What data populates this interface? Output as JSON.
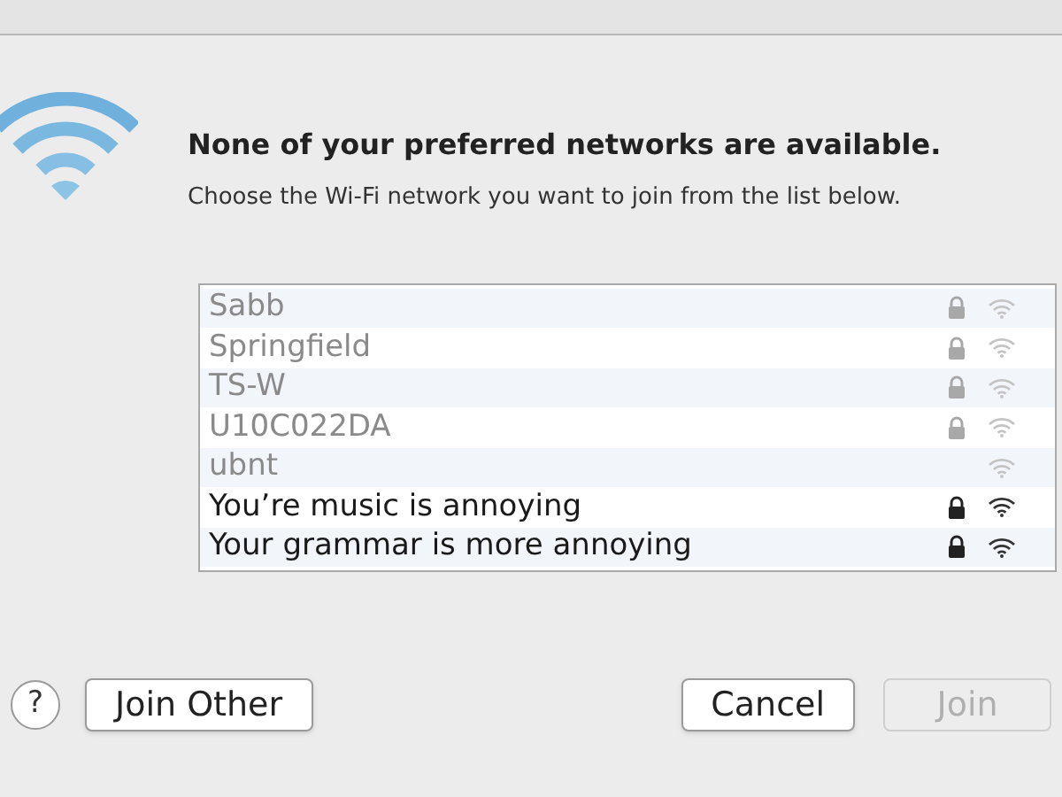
{
  "heading": "None of your preferred networks are available.",
  "message": "Choose the Wi-Fi network you want to join from the list below.",
  "networks": [
    {
      "name": "Sabb",
      "dimmed": true,
      "locked": true
    },
    {
      "name": "Springfield",
      "dimmed": true,
      "locked": true
    },
    {
      "name": "TS-W",
      "dimmed": true,
      "locked": true
    },
    {
      "name": "U10C022DA",
      "dimmed": true,
      "locked": true
    },
    {
      "name": "ubnt",
      "dimmed": true,
      "locked": false
    },
    {
      "name": "You’re music is annoying",
      "dimmed": false,
      "locked": true
    },
    {
      "name": "Your grammar is more annoying",
      "dimmed": false,
      "locked": true
    }
  ],
  "help": "?",
  "left_buttons": [
    {
      "label": "Join Other",
      "disabled": false
    }
  ],
  "right_buttons": [
    {
      "label": "Cancel",
      "disabled": false
    },
    {
      "label": "Join",
      "disabled": true
    }
  ]
}
